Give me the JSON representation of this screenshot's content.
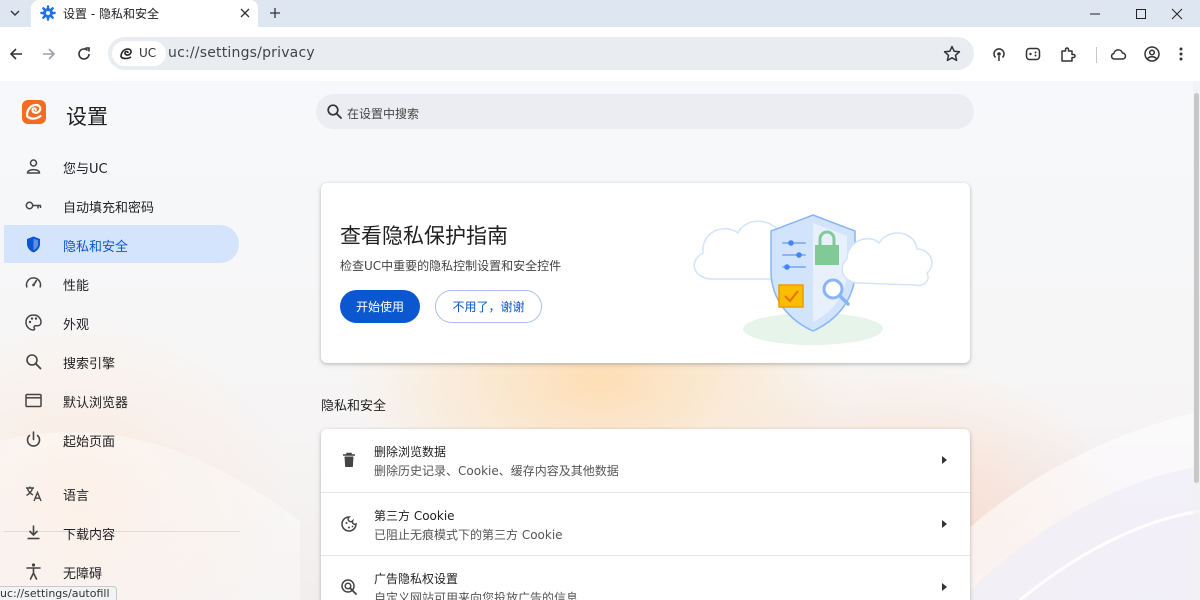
{
  "tab": {
    "title": "设置 - 隐私和安全"
  },
  "omnibox": {
    "chip_label": "UC",
    "url": "uc://settings/privacy"
  },
  "page": {
    "title": "设置",
    "search_placeholder": "在设置中搜索"
  },
  "sidebar": {
    "items": [
      {
        "label": "您与UC",
        "icon": "person-icon"
      },
      {
        "label": "自动填充和密码",
        "icon": "key-icon"
      },
      {
        "label": "隐私和安全",
        "icon": "shield-icon",
        "active": true
      },
      {
        "label": "性能",
        "icon": "gauge-icon"
      },
      {
        "label": "外观",
        "icon": "palette-icon"
      },
      {
        "label": "搜索引擎",
        "icon": "search-icon"
      },
      {
        "label": "默认浏览器",
        "icon": "browser-window-icon"
      },
      {
        "label": "起始页面",
        "icon": "power-icon"
      },
      {
        "label": "语言",
        "icon": "translate-icon"
      },
      {
        "label": "下载内容",
        "icon": "download-icon"
      },
      {
        "label": "无障碍",
        "icon": "accessibility-icon"
      }
    ]
  },
  "promo": {
    "title": "查看隐私保护指南",
    "description": "检查UC中重要的隐私控制设置和安全控件",
    "primary_button": "开始使用",
    "secondary_button": "不用了，谢谢"
  },
  "section": {
    "title": "隐私和安全"
  },
  "privacy_rows": [
    {
      "title": "删除浏览数据",
      "subtitle": "删除历史记录、Cookie、缓存内容及其他数据",
      "icon": "trash-icon"
    },
    {
      "title": "第三方 Cookie",
      "subtitle": "已阻止无痕模式下的第三方 Cookie",
      "icon": "cookie-icon"
    },
    {
      "title": "广告隐私权设置",
      "subtitle": "自定义网站可用来向您投放广告的信息",
      "icon": "ad-privacy-icon"
    }
  ],
  "status_tip": "uc://settings/autofill",
  "colors": {
    "accent": "#0b57d0",
    "active_nav_bg": "#d3e3fd",
    "tab_strip": "#dde6f1"
  }
}
